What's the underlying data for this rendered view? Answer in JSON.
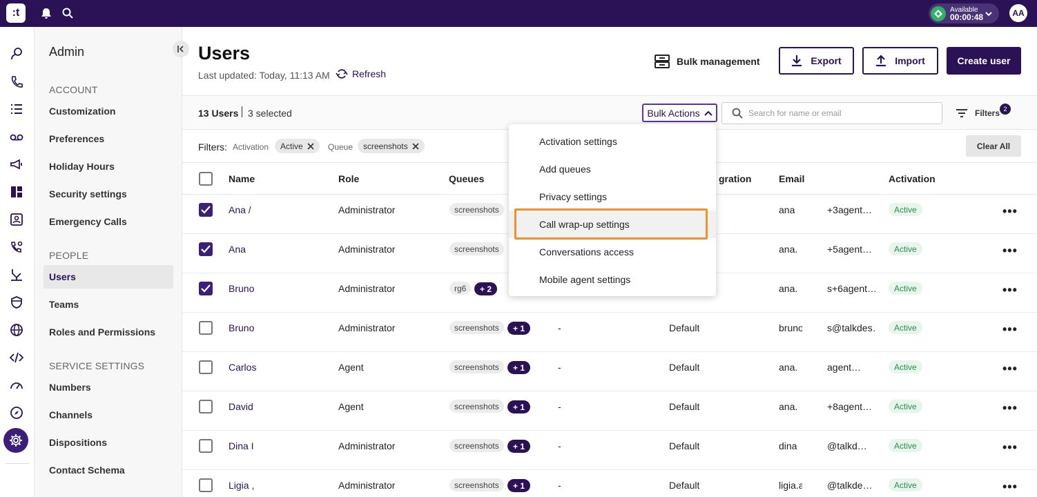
{
  "topbar": {
    "logo_text": ":t",
    "status": {
      "label": "Available",
      "timer": "00:00:48"
    },
    "avatar_initials": "AA"
  },
  "sidebar": {
    "title": "Admin",
    "sections": [
      {
        "label": "ACCOUNT",
        "items": [
          "Customization",
          "Preferences",
          "Holiday Hours",
          "Security settings",
          "Emergency Calls"
        ]
      },
      {
        "label": "PEOPLE",
        "items": [
          "Users",
          "Teams",
          "Roles and Permissions"
        ]
      },
      {
        "label": "SERVICE SETTINGS",
        "items": [
          "Numbers",
          "Channels",
          "Dispositions",
          "Contact Schema"
        ]
      }
    ],
    "active_item": "Users"
  },
  "header": {
    "title": "Users",
    "last_updated": "Last updated: Today, 11:13 AM",
    "refresh_label": "Refresh",
    "bulk_management_label": "Bulk management",
    "export_label": "Export",
    "import_label": "Import",
    "create_label": "Create user"
  },
  "toolbar": {
    "count": "13 Users",
    "selected": "3 selected",
    "bulk_actions_label": "Bulk Actions",
    "search_placeholder": "Search for name or email",
    "filters_label": "Filters",
    "filters_count": "2"
  },
  "filters": {
    "label": "Filters:",
    "activation_key": "Activation",
    "activation_value": "Active",
    "queue_key": "Queue",
    "queue_value": "screenshots",
    "clear_all_label": "Clear All"
  },
  "table": {
    "columns": [
      "Name",
      "Role",
      "Queues",
      "gration",
      "Email",
      "Activation"
    ],
    "rows": [
      {
        "checked": true,
        "name": "Ana /",
        "role": "Administrator",
        "queue": "screenshots",
        "more": "",
        "team": "",
        "integration": "",
        "email_a": "ana",
        "email_b": "+3agent…",
        "activation": "Active"
      },
      {
        "checked": true,
        "name": "Ana",
        "role": "Administrator",
        "queue": "screenshots",
        "more": "",
        "team": "",
        "integration": "",
        "email_a": "ana.",
        "email_b": "+5agent…",
        "activation": "Active"
      },
      {
        "checked": true,
        "name": "Bruno ,",
        "role": "Administrator",
        "queue": "rg6",
        "more": "+ 2",
        "team": "",
        "integration": "",
        "email_a": "ana.",
        "email_b": "s+6agent…",
        "activation": "Active"
      },
      {
        "checked": false,
        "name": "Bruno",
        "role": "Administrator",
        "queue": "screenshots",
        "more": "+ 1",
        "team": "-",
        "integration": "Default",
        "email_a": "bruno.j",
        "email_b": "s@talkdes…",
        "activation": "Active"
      },
      {
        "checked": false,
        "name": "Carlos",
        "role": "Agent",
        "queue": "screenshots",
        "more": "+ 1",
        "team": "-",
        "integration": "Default",
        "email_a": "ana.",
        "email_b": "agent…",
        "activation": "Active"
      },
      {
        "checked": false,
        "name": "David",
        "role": "Agent",
        "queue": "screenshots",
        "more": "+ 1",
        "team": "-",
        "integration": "Default",
        "email_a": "ana.",
        "email_b": "+8agent…",
        "activation": "Active"
      },
      {
        "checked": false,
        "name": "Dina I",
        "role": "Administrator",
        "queue": "screenshots",
        "more": "+ 1",
        "team": "-",
        "integration": "Default",
        "email_a": "dina",
        "email_b": "@talkd…",
        "activation": "Active"
      },
      {
        "checked": false,
        "name": "Ligia ,",
        "role": "Administrator",
        "queue": "screenshots",
        "more": "+ 1",
        "team": "-",
        "integration": "Default",
        "email_a": "ligia.a",
        "email_b": "@talkde…",
        "activation": "Active"
      }
    ]
  },
  "bulk_menu": {
    "items": [
      "Activation settings",
      "Add queues",
      "Privacy settings",
      "Call wrap-up settings",
      "Conversations access",
      "Mobile agent settings"
    ],
    "highlighted": "Call wrap-up settings"
  },
  "colors": {
    "brand": "#2b1155",
    "accent": "#5c2fb0",
    "success": "#2fb265",
    "highlight_outline": "#f0922b"
  }
}
